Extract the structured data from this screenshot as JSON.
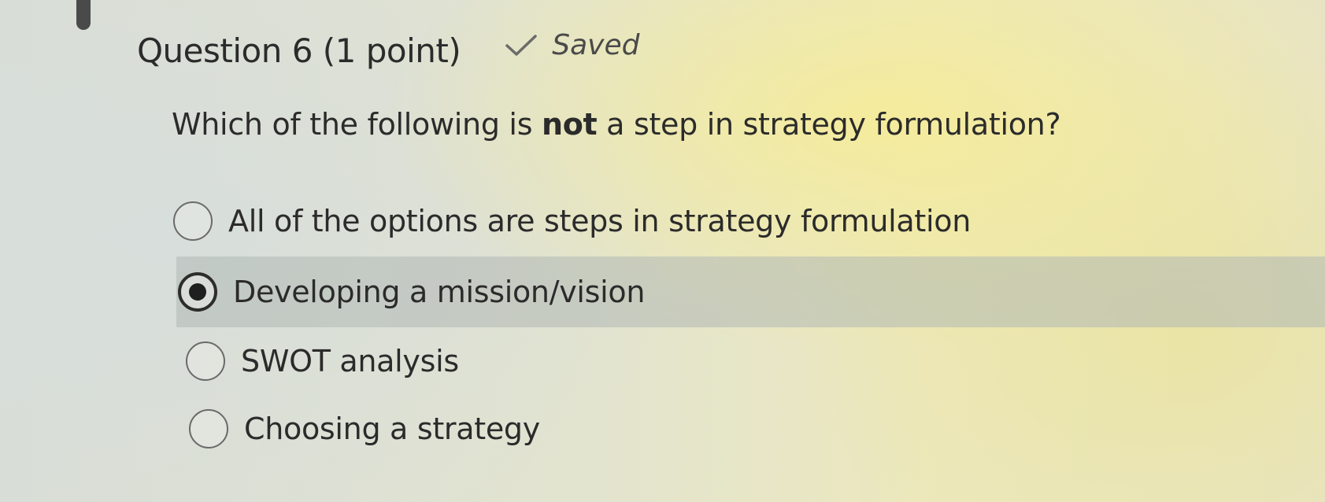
{
  "question": {
    "title": "Question 6 (1 point)",
    "status_label": "Saved",
    "status_icon": "check-icon",
    "text_before": "Which of the following is ",
    "text_emphasis": "not",
    "text_after": " a step in strategy formulation?"
  },
  "options": [
    {
      "label": "All of the options are steps in strategy formulation",
      "selected": false
    },
    {
      "label": "Developing a mission/vision",
      "selected": true
    },
    {
      "label": "SWOT analysis",
      "selected": false
    },
    {
      "label": "Choosing a strategy",
      "selected": false
    }
  ],
  "colors": {
    "text": "#2b2b2b",
    "selected_row": "#b0b8b4",
    "radio_border": "#6a6a6a"
  }
}
